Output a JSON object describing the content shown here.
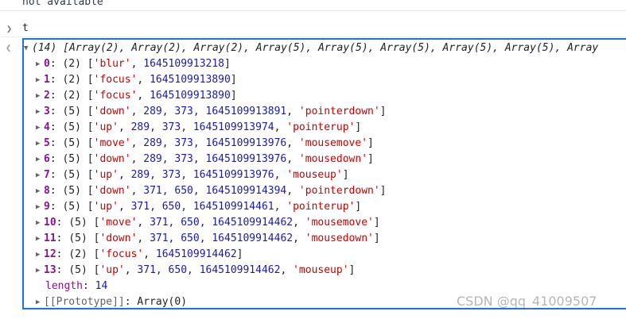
{
  "console": {
    "prev_output": "not available",
    "input_command": "t",
    "array_summary": "(14) [Array(2), Array(2), Array(2), Array(5), Array(5), Array(5), Array(5), Array(5), Array",
    "items": [
      {
        "key": "0",
        "len": "(2)",
        "str": "'blur'",
        "nums": "1645109913218",
        "tail": ""
      },
      {
        "key": "1",
        "len": "(2)",
        "str": "'focus'",
        "nums": "1645109913890",
        "tail": ""
      },
      {
        "key": "2",
        "len": "(2)",
        "str": "'focus'",
        "nums": "1645109913890",
        "tail": ""
      },
      {
        "key": "3",
        "len": "(5)",
        "str": "'down'",
        "nums": "289, 373, 1645109913891",
        "tail": "'pointerdown'"
      },
      {
        "key": "4",
        "len": "(5)",
        "str": "'up'",
        "nums": "289, 373, 1645109913974",
        "tail": "'pointerup'"
      },
      {
        "key": "5",
        "len": "(5)",
        "str": "'move'",
        "nums": "289, 373, 1645109913976",
        "tail": "'mousemove'"
      },
      {
        "key": "6",
        "len": "(5)",
        "str": "'down'",
        "nums": "289, 373, 1645109913976",
        "tail": "'mousedown'"
      },
      {
        "key": "7",
        "len": "(5)",
        "str": "'up'",
        "nums": "289, 373, 1645109913976",
        "tail": "'mouseup'"
      },
      {
        "key": "8",
        "len": "(5)",
        "str": "'down'",
        "nums": "371, 650, 1645109914394",
        "tail": "'pointerdown'"
      },
      {
        "key": "9",
        "len": "(5)",
        "str": "'up'",
        "nums": "371, 650, 1645109914461",
        "tail": "'pointerup'"
      },
      {
        "key": "10",
        "len": "(5)",
        "str": "'move'",
        "nums": "371, 650, 1645109914462",
        "tail": "'mousemove'"
      },
      {
        "key": "11",
        "len": "(5)",
        "str": "'down'",
        "nums": "371, 650, 1645109914462",
        "tail": "'mousedown'"
      },
      {
        "key": "12",
        "len": "(2)",
        "str": "'focus'",
        "nums": "1645109914462",
        "tail": ""
      },
      {
        "key": "13",
        "len": "(5)",
        "str": "'up'",
        "nums": "371, 650, 1645109914462",
        "tail": "'mouseup'"
      }
    ],
    "length_key": "length",
    "length_value": "14",
    "prototype_key": "[[Prototype]]",
    "prototype_value": "Array(0)"
  },
  "watermark": "CSDN @qq_41009507",
  "colors": {
    "focus_border": "#1a73e8",
    "key": "#881391",
    "string": "#c80000",
    "number": "#1a1aa6"
  },
  "icons": {
    "prompt": "chevron-right-icon",
    "return": "chevron-left-icon",
    "expand": "triangle-icon"
  }
}
